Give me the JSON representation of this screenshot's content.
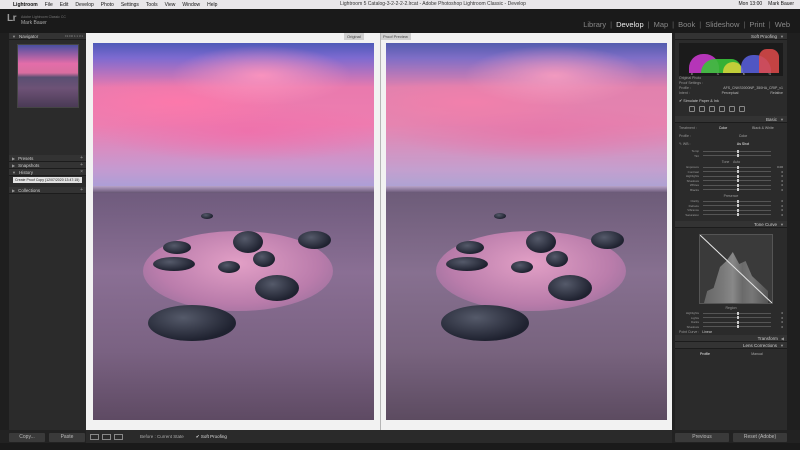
{
  "menubar": {
    "app": "Lightroom",
    "items": [
      "File",
      "Edit",
      "Develop",
      "Photo",
      "Settings",
      "Tools",
      "View",
      "Window",
      "Help"
    ],
    "window_title": "Lightroom 5 Catalog-3-2-2-2-2.lrcat - Adobe Photoshop Lightroom Classic - Develop",
    "right": [
      "Mon 13:00",
      "Mark Bauer"
    ]
  },
  "identity": {
    "logo": "Lr",
    "catalog": "Adobe Lightroom Classic CC",
    "user": "Mark Bauer"
  },
  "modules": [
    "Library",
    "Develop",
    "Map",
    "Book",
    "Slideshow",
    "Print",
    "Web"
  ],
  "active_module": "Develop",
  "left_panel": {
    "navigator": "Navigator",
    "zoom_options": "Fit  Fill  1:1  3:1",
    "sections": [
      "Presets",
      "Snapshots",
      "History",
      "Collections"
    ],
    "history_item": "Create Proof Copy (12/07/2020 13:47:15)",
    "copy_label": "Copy...",
    "paste_label": "Paste"
  },
  "center": {
    "before_label": "Original",
    "after_label": "Proof Preview"
  },
  "toolbar": {
    "before_label": "Before : Current State",
    "soft_proofing_label": "Soft Proofing"
  },
  "right_panel": {
    "soft_proofing": "Soft Proofing",
    "histogram_readout": [
      "R",
      "G",
      "B",
      "%"
    ],
    "original_photo": "Original Photo",
    "proof_settings": "Proof Settings :",
    "profile_label": "Profile :",
    "profile_value": "AFS_CNKS0000NP_350HA_CRIP_v1",
    "intent_label": "Intent :",
    "intent_perceptual": "Perceptual",
    "intent_relative": "Relative",
    "simulate_paper": "Simulate Paper & Ink",
    "basic": "Basic",
    "treatment_label": "Treatment :",
    "treatment_color": "Color",
    "treatment_bw": "Black & White",
    "profile_color_label": "Profile :",
    "profile_color_value": "Color",
    "wb_label": "WB :",
    "wb_value": "As Shot",
    "temp_sliders": [
      {
        "label": "Temp",
        "value": ""
      },
      {
        "label": "Tint",
        "value": ""
      }
    ],
    "tone_label": "Tone",
    "tone_auto": "Auto",
    "tone_sliders": [
      {
        "label": "Exposure",
        "value": "0.00"
      },
      {
        "label": "Contrast",
        "value": "0"
      },
      {
        "label": "Highlights",
        "value": "0"
      },
      {
        "label": "Shadows",
        "value": "0"
      },
      {
        "label": "Whites",
        "value": "0"
      },
      {
        "label": "Blacks",
        "value": "0"
      }
    ],
    "presence_label": "Presence",
    "presence_sliders": [
      {
        "label": "Clarity",
        "value": "0"
      },
      {
        "label": "Dehaze",
        "value": "0"
      },
      {
        "label": "Vibrance",
        "value": "0"
      },
      {
        "label": "Saturation",
        "value": "0"
      }
    ],
    "tone_curve": "Tone Curve",
    "region_label": "Region",
    "region_sliders": [
      {
        "label": "Highlights",
        "value": "0"
      },
      {
        "label": "Lights",
        "value": "0"
      },
      {
        "label": "Darks",
        "value": "0"
      },
      {
        "label": "Shadows",
        "value": "0"
      }
    ],
    "point_curve_label": "Point Curve :",
    "point_curve_value": "Linear",
    "transform": "Transform",
    "lens_corrections": "Lens Corrections",
    "lens_profile": "Profile",
    "lens_manual": "Manual",
    "previous_label": "Previous",
    "reset_label": "Reset (Adobe)"
  }
}
